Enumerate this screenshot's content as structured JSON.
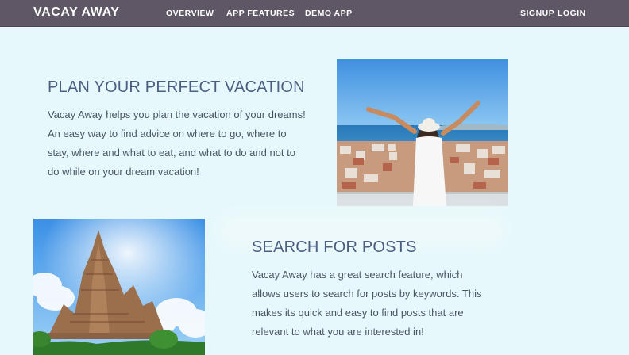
{
  "navbar": {
    "brand": "VACAY AWAY",
    "links": [
      "OVERVIEW",
      "APP FEATURES",
      "DEMO APP"
    ],
    "signup": "SIGNUP",
    "login": "LOGIN"
  },
  "section1": {
    "title": "PLAN YOUR PERFECT VACATION",
    "text": "Vacay Away helps you plan the vacation of your dreams! An easy way to find advice on where to go, where to stay, where and what to eat, and what to do and not to do while on your dream vacation!"
  },
  "section2": {
    "title": "SEARCH FOR POSTS",
    "text": "Vacay Away has a great search feature, which allows users to search for posts by keywords. This makes its quick and easy to find posts that are relevant to what you are interested in!"
  },
  "colors": {
    "navbar": "#5f5765",
    "background": "#e6f8fb",
    "heading": "#4a5f82",
    "body_text": "#4b5665"
  }
}
